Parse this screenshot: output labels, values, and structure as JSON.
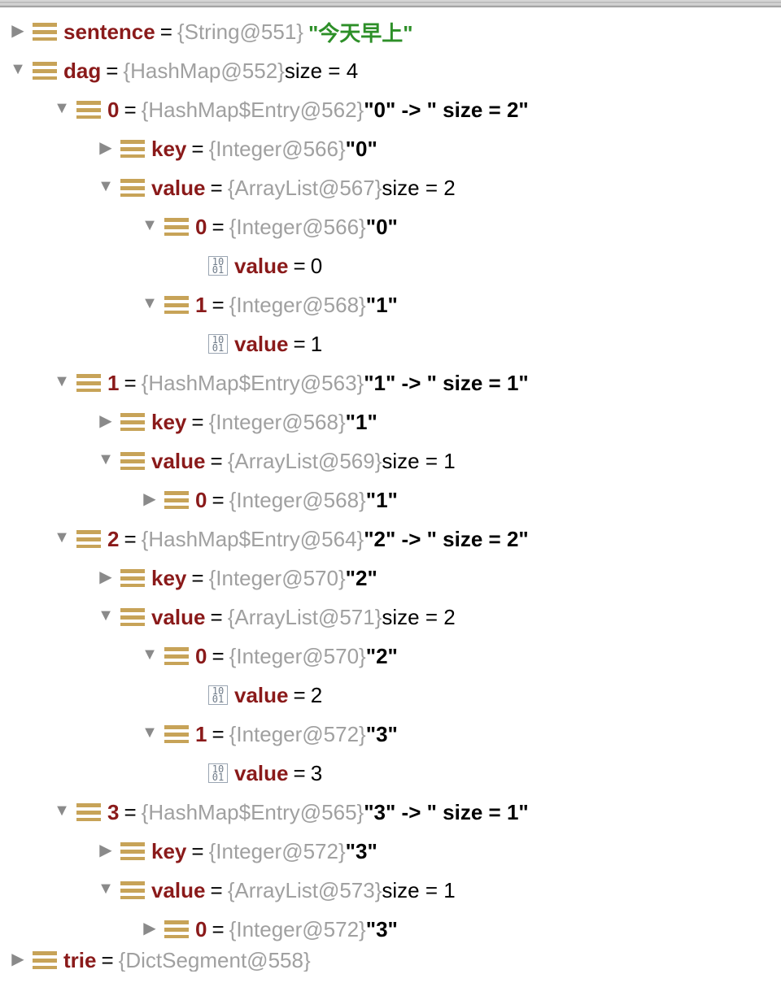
{
  "rows": [
    {
      "indent": 0,
      "arrow": "right",
      "icon": "bars",
      "name": "sentence",
      "eq": true,
      "type": "{String@551}",
      "tail_str": "\"今天早上\""
    },
    {
      "indent": 0,
      "arrow": "down",
      "icon": "bars",
      "name": "dag",
      "eq": true,
      "type": "{HashMap@552}",
      "tail": "  size = 4"
    },
    {
      "indent": 1,
      "arrow": "down",
      "icon": "bars",
      "idx": "0",
      "eq": true,
      "type": "{HashMap$Entry@562}",
      "tail_q": " \"0\" -> \" size = 2\""
    },
    {
      "indent": 2,
      "arrow": "right",
      "icon": "bars",
      "name": "key",
      "eq": true,
      "type": "{Integer@566}",
      "tail_q": " \"0\""
    },
    {
      "indent": 2,
      "arrow": "down",
      "icon": "bars",
      "name": "value",
      "eq": true,
      "type": "{ArrayList@567}",
      "tail": "  size = 2"
    },
    {
      "indent": 3,
      "arrow": "down",
      "icon": "bars",
      "idx": "0",
      "eq": true,
      "type": "{Integer@566}",
      "tail_q": " \"0\""
    },
    {
      "indent": 4,
      "arrow": "none",
      "icon": "bin",
      "name": "value",
      "eq": true,
      "tail": "0"
    },
    {
      "indent": 3,
      "arrow": "down",
      "icon": "bars",
      "idx": "1",
      "eq": true,
      "type": "{Integer@568}",
      "tail_q": " \"1\""
    },
    {
      "indent": 4,
      "arrow": "none",
      "icon": "bin",
      "name": "value",
      "eq": true,
      "tail": "1"
    },
    {
      "indent": 1,
      "arrow": "down",
      "icon": "bars",
      "idx": "1",
      "eq": true,
      "type": "{HashMap$Entry@563}",
      "tail_q": " \"1\" -> \" size = 1\""
    },
    {
      "indent": 2,
      "arrow": "right",
      "icon": "bars",
      "name": "key",
      "eq": true,
      "type": "{Integer@568}",
      "tail_q": " \"1\""
    },
    {
      "indent": 2,
      "arrow": "down",
      "icon": "bars",
      "name": "value",
      "eq": true,
      "type": "{ArrayList@569}",
      "tail": "  size = 1"
    },
    {
      "indent": 3,
      "arrow": "right",
      "icon": "bars",
      "idx": "0",
      "eq": true,
      "type": "{Integer@568}",
      "tail_q": " \"1\""
    },
    {
      "indent": 1,
      "arrow": "down",
      "icon": "bars",
      "idx": "2",
      "eq": true,
      "type": "{HashMap$Entry@564}",
      "tail_q": " \"2\" -> \" size = 2\""
    },
    {
      "indent": 2,
      "arrow": "right",
      "icon": "bars",
      "name": "key",
      "eq": true,
      "type": "{Integer@570}",
      "tail_q": " \"2\""
    },
    {
      "indent": 2,
      "arrow": "down",
      "icon": "bars",
      "name": "value",
      "eq": true,
      "type": "{ArrayList@571}",
      "tail": "  size = 2"
    },
    {
      "indent": 3,
      "arrow": "down",
      "icon": "bars",
      "idx": "0",
      "eq": true,
      "type": "{Integer@570}",
      "tail_q": " \"2\""
    },
    {
      "indent": 4,
      "arrow": "none",
      "icon": "bin",
      "name": "value",
      "eq": true,
      "tail": "2"
    },
    {
      "indent": 3,
      "arrow": "down",
      "icon": "bars",
      "idx": "1",
      "eq": true,
      "type": "{Integer@572}",
      "tail_q": " \"3\""
    },
    {
      "indent": 4,
      "arrow": "none",
      "icon": "bin",
      "name": "value",
      "eq": true,
      "tail": "3"
    },
    {
      "indent": 1,
      "arrow": "down",
      "icon": "bars",
      "idx": "3",
      "eq": true,
      "type": "{HashMap$Entry@565}",
      "tail_q": " \"3\" -> \" size = 1\""
    },
    {
      "indent": 2,
      "arrow": "right",
      "icon": "bars",
      "name": "key",
      "eq": true,
      "type": "{Integer@572}",
      "tail_q": " \"3\""
    },
    {
      "indent": 2,
      "arrow": "down",
      "icon": "bars",
      "name": "value",
      "eq": true,
      "type": "{ArrayList@573}",
      "tail": "  size = 1"
    },
    {
      "indent": 3,
      "arrow": "right",
      "icon": "bars",
      "idx": "0",
      "eq": true,
      "type": "{Integer@572}",
      "tail_q": " \"3\""
    },
    {
      "indent": 0,
      "arrow": "right",
      "icon": "bars",
      "name": "trie",
      "eq": true,
      "type": "{DictSegment@558}",
      "cut": true
    }
  ],
  "indentBase": 10,
  "indentStep": 54
}
